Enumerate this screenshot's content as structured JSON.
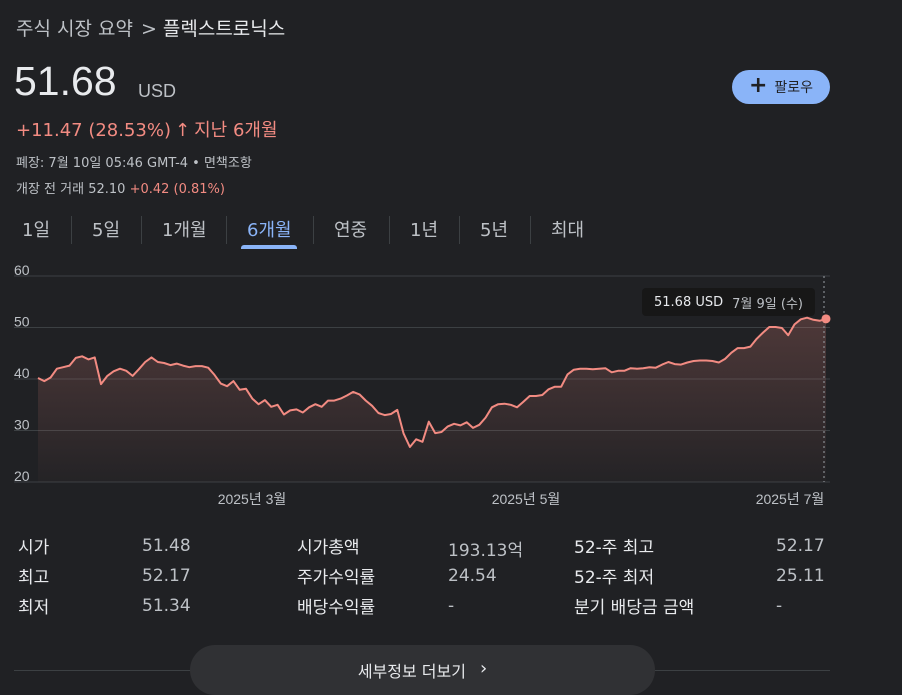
{
  "breadcrumb": {
    "section": "주식 시장 요약",
    "separator": ">",
    "company": "플렉스트로닉스"
  },
  "quote": {
    "price": "51.68",
    "currency": "USD",
    "change": "+11.47 (28.53%)",
    "change_arrow": "↑",
    "period": "지난 6개월",
    "close_info": "폐장: 7월 10일 05:46 GMT-4 • 면책조항",
    "premarket_label": "개장 전 거래 52.10",
    "premarket_change": "+0.42 (0.81%)"
  },
  "follow": {
    "icon": "plus-icon",
    "label": "팔로우"
  },
  "tabs": [
    {
      "label": "1일"
    },
    {
      "label": "5일"
    },
    {
      "label": "1개월"
    },
    {
      "label": "6개월",
      "active": true
    },
    {
      "label": "연중"
    },
    {
      "label": "1년"
    },
    {
      "label": "5년"
    },
    {
      "label": "최대"
    }
  ],
  "tooltip": {
    "price": "51.68 USD",
    "date": "7월 9일 (수)"
  },
  "chart_data": {
    "type": "area",
    "y_ticks": [
      "60",
      "50",
      "40",
      "30",
      "20"
    ],
    "ylim": [
      20,
      60
    ],
    "x_ticks": [
      "2025년 3월",
      "2025년 5월",
      "2025년 7월"
    ],
    "color": "#f28b82",
    "grid": true,
    "values": [
      40.2,
      39.6,
      40.3,
      42.0,
      42.3,
      42.6,
      44.1,
      44.4,
      43.8,
      44.2,
      39.0,
      40.6,
      41.5,
      42.0,
      41.6,
      40.6,
      41.9,
      43.3,
      44.2,
      43.3,
      43.1,
      42.7,
      43.0,
      42.6,
      42.3,
      42.5,
      42.5,
      42.2,
      40.8,
      39.1,
      38.6,
      39.6,
      37.9,
      38.1,
      36.2,
      35.1,
      35.9,
      34.6,
      35.0,
      33.1,
      33.9,
      34.1,
      33.5,
      34.5,
      35.1,
      34.6,
      35.8,
      35.8,
      36.2,
      36.8,
      37.5,
      37.0,
      35.8,
      34.8,
      33.4,
      33.0,
      33.2,
      34.0,
      29.4,
      26.8,
      28.3,
      27.8,
      31.7,
      29.5,
      29.7,
      30.8,
      31.3,
      31.0,
      31.6,
      30.5,
      31.1,
      32.5,
      34.5,
      35.1,
      35.2,
      35.0,
      34.5,
      35.6,
      36.7,
      36.7,
      36.9,
      38.0,
      38.5,
      38.5,
      40.9,
      41.8,
      42.0,
      42.0,
      41.9,
      42.0,
      42.1,
      41.3,
      41.6,
      41.6,
      42.1,
      42.0,
      42.1,
      42.3,
      42.2,
      42.8,
      43.3,
      42.9,
      42.8,
      43.2,
      43.5,
      43.6,
      43.6,
      43.5,
      43.2,
      43.9,
      45.1,
      46.0,
      46.0,
      46.3,
      47.8,
      49.0,
      50.1,
      50.1,
      49.9,
      48.5,
      50.6,
      51.6,
      51.9,
      51.5,
      51.3,
      51.68
    ]
  },
  "stats": {
    "col1": [
      {
        "label": "시가",
        "value": "51.48"
      },
      {
        "label": "최고",
        "value": "52.17"
      },
      {
        "label": "최저",
        "value": "51.34"
      }
    ],
    "col2": [
      {
        "label": "시가총액",
        "value": "193.13억"
      },
      {
        "label": "주가수익률",
        "value": "24.54"
      },
      {
        "label": "배당수익률",
        "value": "-"
      }
    ],
    "col3": [
      {
        "label": "52-주 최고",
        "value": "52.17"
      },
      {
        "label": "52-주 최저",
        "value": "25.11"
      },
      {
        "label": "분기 배당금 금액",
        "value": "-"
      }
    ]
  },
  "more_button": {
    "label": "세부정보 더보기",
    "icon": "chevron-right-icon"
  }
}
